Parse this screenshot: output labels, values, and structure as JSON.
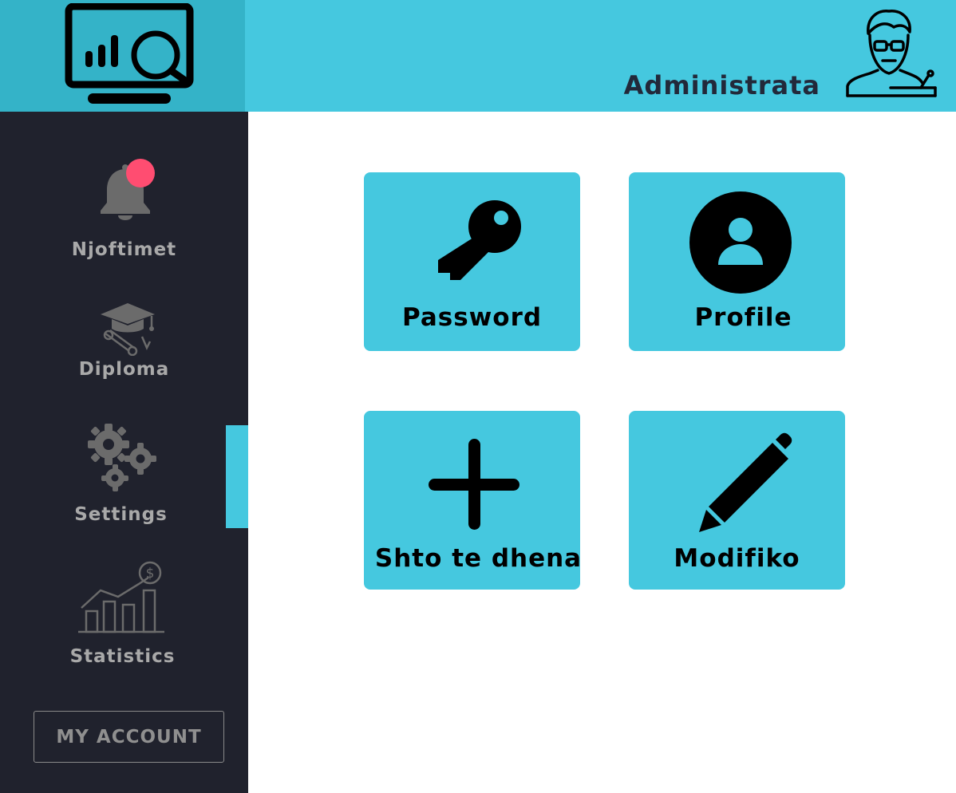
{
  "header": {
    "user_name": "Administrata",
    "logo_icon": "monitor-analytics-icon",
    "avatar_icon": "admin-speaker-avatar-icon",
    "background_color": "#45c8df",
    "logo_background_color": "#34b3c8"
  },
  "sidebar": {
    "background_color": "#20222d",
    "active_indicator_color": "#45c8df",
    "items": [
      {
        "label": "Njoftimet",
        "icon": "bell-icon",
        "has_notification": true,
        "notification_color": "#ff4d71"
      },
      {
        "label": "Diploma",
        "icon": "graduation-diploma-icon"
      },
      {
        "label": "Settings",
        "icon": "gears-icon",
        "active": true
      },
      {
        "label": "Statistics",
        "icon": "stats-chart-icon"
      }
    ],
    "account_button": "MY ACCOUNT"
  },
  "main": {
    "tiles": [
      {
        "label": "Password",
        "icon": "key-icon"
      },
      {
        "label": "Profile",
        "icon": "profile-icon"
      },
      {
        "label": "Shto te dhena",
        "icon": "plus-icon"
      },
      {
        "label": "Modifiko",
        "icon": "pencil-icon"
      }
    ],
    "tile_color": "#45c8df"
  }
}
